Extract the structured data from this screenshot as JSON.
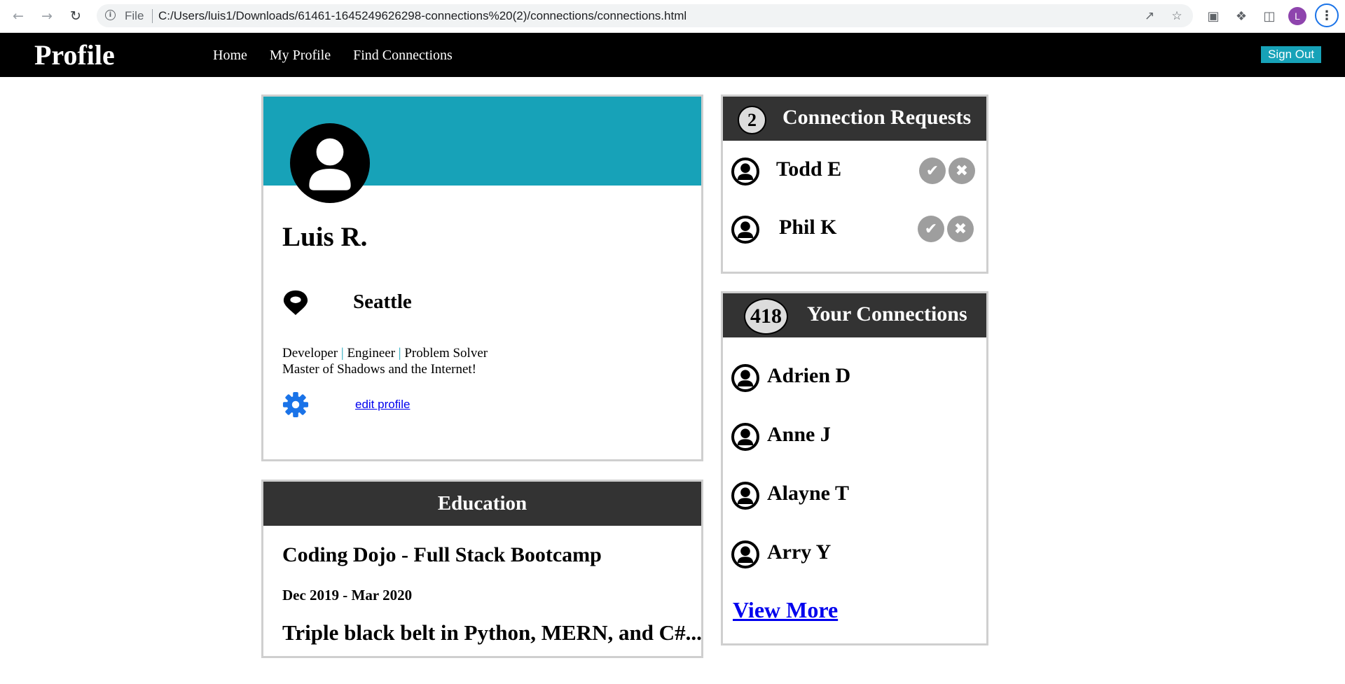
{
  "browser": {
    "file_label": "File",
    "url": "C:/Users/luis1/Downloads/61461-1645249626298-connections%20(2)/connections/connections.html",
    "profile_initial": "L"
  },
  "header": {
    "brand": "Profile",
    "nav": [
      "Home",
      "My Profile",
      "Find Connections"
    ],
    "signout": "Sign Out",
    "accent": "#17a2b8"
  },
  "profile": {
    "name": "Luis R.",
    "city": "Seattle",
    "bio": {
      "roles": [
        "Developer",
        "Engineer",
        "Problem Solver"
      ],
      "line2": "Master of Shadows and the Internet!"
    },
    "edit_label": "edit profile"
  },
  "education": {
    "heading": "Education",
    "school": "Coding Dojo - Full Stack Bootcamp",
    "dates": "Dec 2019 - Mar 2020",
    "detail": "Triple black belt in Python, MERN, and C#..."
  },
  "requests": {
    "count": "2",
    "title": "Connection Requests",
    "people": [
      "Todd E",
      "Phil K"
    ]
  },
  "connections": {
    "count": "418",
    "title": "Your Connections",
    "people": [
      "Adrien D",
      "Anne J",
      "Alayne T",
      "Arry Y"
    ],
    "view_more": "View More"
  },
  "icons": {
    "avatar": "user-circle-icon",
    "location": "map-pin-icon",
    "settings": "gear-icon",
    "accept": "check-icon",
    "decline": "x-icon"
  }
}
